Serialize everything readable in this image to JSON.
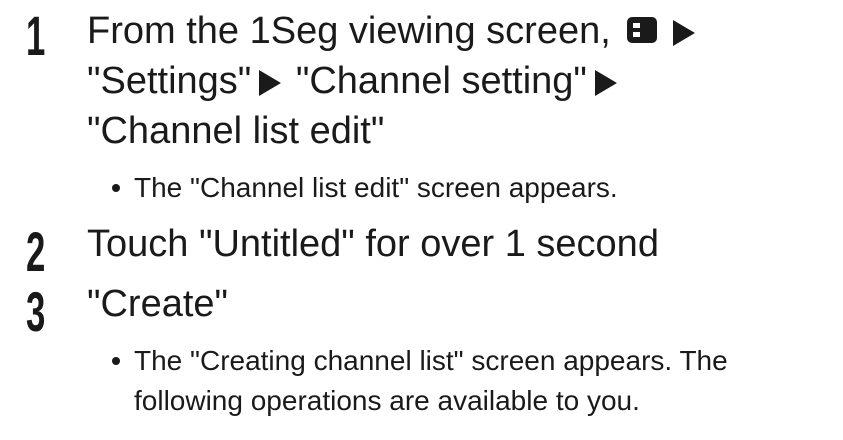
{
  "steps": [
    {
      "number": "1",
      "line1_part1": "From the 1Seg viewing screen,",
      "menu_icon": "menu-key-icon",
      "line2_part1": "\"Settings\"",
      "line2_part2": "\"Channel setting\"",
      "line3": "\"Channel list edit\"",
      "note": "The \"Channel list edit\" screen appears."
    },
    {
      "number": "2",
      "text": "Touch \"Untitled\" for over 1 second"
    },
    {
      "number": "3",
      "text": "\"Create\"",
      "note_line1": "The \"Creating channel list\" screen appears. The",
      "note_line2": "following operations are available to you."
    }
  ],
  "arrow_icon": "right-triangle-icon",
  "text_color": "#1a1a1a"
}
